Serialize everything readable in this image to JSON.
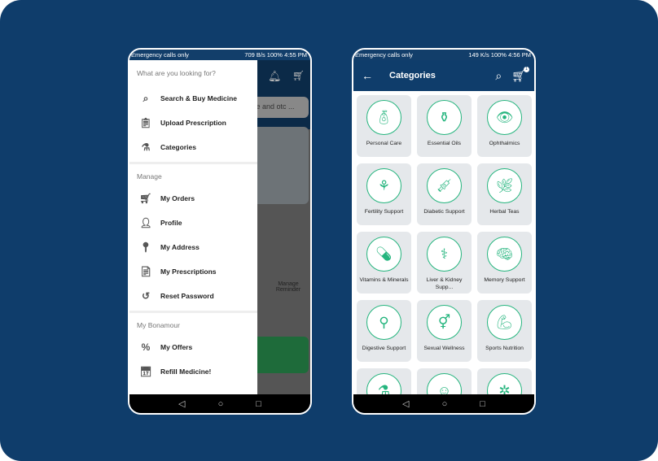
{
  "left_phone": {
    "status": {
      "left": "Emergency calls only",
      "right": "709 B/s  100%  4:55 PM"
    },
    "background": {
      "search_partial": "cine and otc ...",
      "reminder": "Manage Reminder"
    },
    "drawer": {
      "section1": "What are you looking for?",
      "items1": [
        {
          "label": "Search & Buy Medicine",
          "icon": "search-icon"
        },
        {
          "label": "Upload Prescription",
          "icon": "prescription-icon"
        },
        {
          "label": "Categories",
          "icon": "categories-icon"
        }
      ],
      "section2": "Manage",
      "items2": [
        {
          "label": "My Orders",
          "icon": "cart-icon"
        },
        {
          "label": "Profile",
          "icon": "profile-icon"
        },
        {
          "label": "My Address",
          "icon": "location-icon"
        },
        {
          "label": "My Prescriptions",
          "icon": "prescription-icon"
        },
        {
          "label": "Reset Password",
          "icon": "reset-icon"
        }
      ],
      "section3": "My Bonamour",
      "items3": [
        {
          "label": "My Offers",
          "icon": "offer-icon"
        },
        {
          "label": "Refill Medicine!",
          "icon": "calendar-icon"
        }
      ]
    }
  },
  "right_phone": {
    "status": {
      "left": "Emergency calls only",
      "right": "149 K/s  100%  4:56 PM"
    },
    "header": {
      "title": "Categories",
      "cart_count": "1"
    },
    "categories": [
      "Personal Care",
      "Essential Oils",
      "Ophthalmics",
      "Fertility Support",
      "Diabetic Support",
      "Herbal Teas",
      "Vitamins & Minerals",
      "Liver & Kidney Supp...",
      "Memory Support",
      "Digestive Support",
      "Sexual Wellness",
      "Sports Nutrition",
      "",
      "",
      ""
    ]
  },
  "colors": {
    "brand": "#0f3d6b",
    "accent": "#25b57e"
  }
}
